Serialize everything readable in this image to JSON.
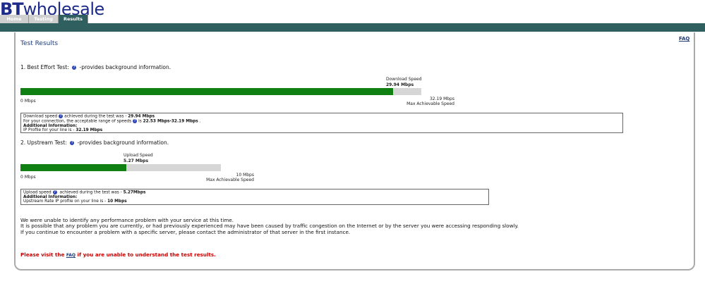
{
  "logo": {
    "bt": "BT",
    "wholesale": "wholesale"
  },
  "tabs": [
    {
      "label": "Home"
    },
    {
      "label": "Testing"
    },
    {
      "label": "Results"
    }
  ],
  "faq_link": "FAQ",
  "page_title": "Test Results",
  "best_effort": {
    "heading": "1. Best Effort Test:",
    "heading_suffix": "-provides background information.",
    "speed_label": "Download Speed",
    "speed_value": "29.94 Mbps",
    "min_label": "0 Mbps",
    "max_value": "32.19 Mbps",
    "max_label": "Max Achievable Speed",
    "fill_fraction": 0.93,
    "info": {
      "line1_prefix": "Download speed",
      "line1_mid": "achieved during the test was - ",
      "line1_value": "29.94 Mbps",
      "line2_prefix": "For your connection, the acceptable range of speeds",
      "line2_mid": "is ",
      "line2_value": "22.53 Mbps-32.19 Mbps",
      "line2_suffix": " .",
      "additional": "Additional Information:",
      "line3_prefix": "IP Profile for your line is - ",
      "line3_value": "32.19 Mbps"
    }
  },
  "upstream": {
    "heading": "2. Upstream Test:",
    "heading_suffix": "-provides background information.",
    "speed_label": "Upload Speed",
    "speed_value": "5.27 Mbps",
    "min_label": "0 Mbps",
    "max_value": "10 Mbps",
    "max_label": "Max Achievable Speed",
    "fill_fraction": 0.527,
    "info": {
      "line1_prefix": "Upload speed",
      "line1_mid": " achieved during the test was - ",
      "line1_value": "5.27Mbps",
      "additional": "Additional Information:",
      "line2_prefix": "Upstream Rate IP profile on your line is - ",
      "line2_value": "10 Mbps"
    }
  },
  "summary": [
    "We were unable to identify any performance problem with your service at this time.",
    "It is possible that any problem you are currently, or had previously experienced may have been caused by traffic congestion on the Internet or by the server you were accessing responding slowly.",
    "If you continue to encounter a problem with a specific server, please contact the administrator of that server in the first instance."
  ],
  "note": {
    "prefix": "Please visit the ",
    "link": "FAQ",
    "suffix": " if you are unable to understand the test results."
  },
  "colors": {
    "brand": "#1c2a8a",
    "teal": "#2f5f5e",
    "bar_fill": "#118013",
    "bar_track": "#d6d6d6",
    "note": "#cc0000"
  }
}
